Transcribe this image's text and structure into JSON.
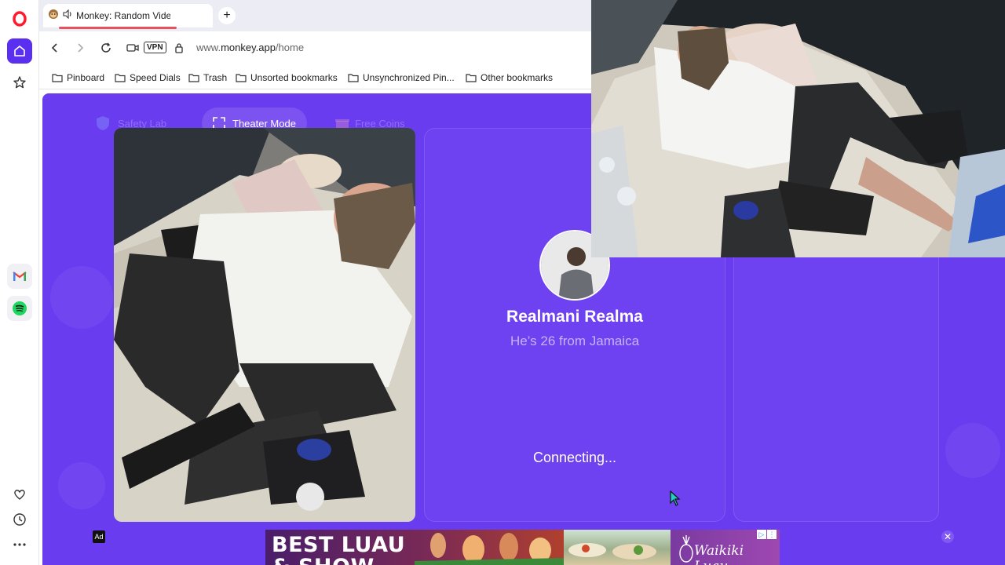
{
  "browser": {
    "tab": {
      "title": "Monkey: Random Video Chat",
      "favicon": "monkey-icon",
      "audio_icon": "speaker-icon"
    },
    "newtab_icon": "plus-icon",
    "address": {
      "vpn_label": "VPN",
      "url_prefix": "www.",
      "url_domain": "monkey.app",
      "url_path": "/home"
    },
    "bookmarks": [
      {
        "label": "Pinboard"
      },
      {
        "label": "Speed Dials"
      },
      {
        "label": "Trash"
      },
      {
        "label": "Unsorted bookmarks"
      },
      {
        "label": "Unsynchronized Pin..."
      },
      {
        "label": "Other bookmarks"
      }
    ],
    "sidebar": {
      "items": [
        "opera-logo-icon",
        "home-icon",
        "star-icon",
        "gmail-icon",
        "spotify-icon",
        "heart-icon",
        "history-icon",
        "more-icon"
      ]
    }
  },
  "monkey": {
    "top_buttons": {
      "safety_lab": "Safety Lab",
      "theater_mode": "Theater Mode",
      "free_coins": "Free Coins"
    },
    "profile": {
      "name": "Realmani Realma",
      "subtitle": "He’s 26 from Jamaica",
      "status": "Connecting..."
    },
    "accent": "#6a3cf0"
  },
  "ad": {
    "label": "Ad",
    "headline": "BEST LUAU",
    "headline_line2": "& SHOW",
    "brand": "Waikiki Luau",
    "close": "✕",
    "adchoices": [
      "▷",
      "⋮"
    ]
  }
}
